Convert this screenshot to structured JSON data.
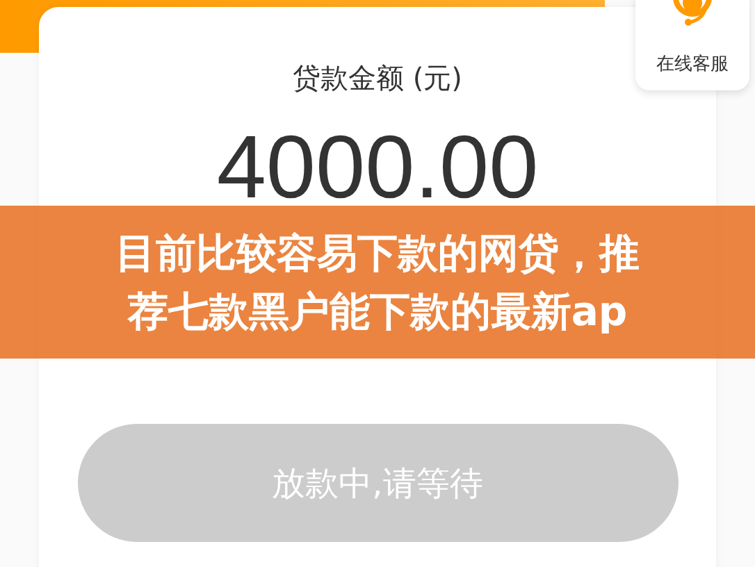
{
  "header": {
    "kind": "orange"
  },
  "loan": {
    "label": "贷款金额 (元)",
    "amount": "4000.00"
  },
  "support": {
    "label": "在线客服"
  },
  "action_button": {
    "label": "放款中,请等待",
    "disabled": true
  },
  "banner": {
    "lines": [
      "目前比较容易下款的网贷，推",
      "荐七款黑户能下款的最新ap"
    ]
  }
}
